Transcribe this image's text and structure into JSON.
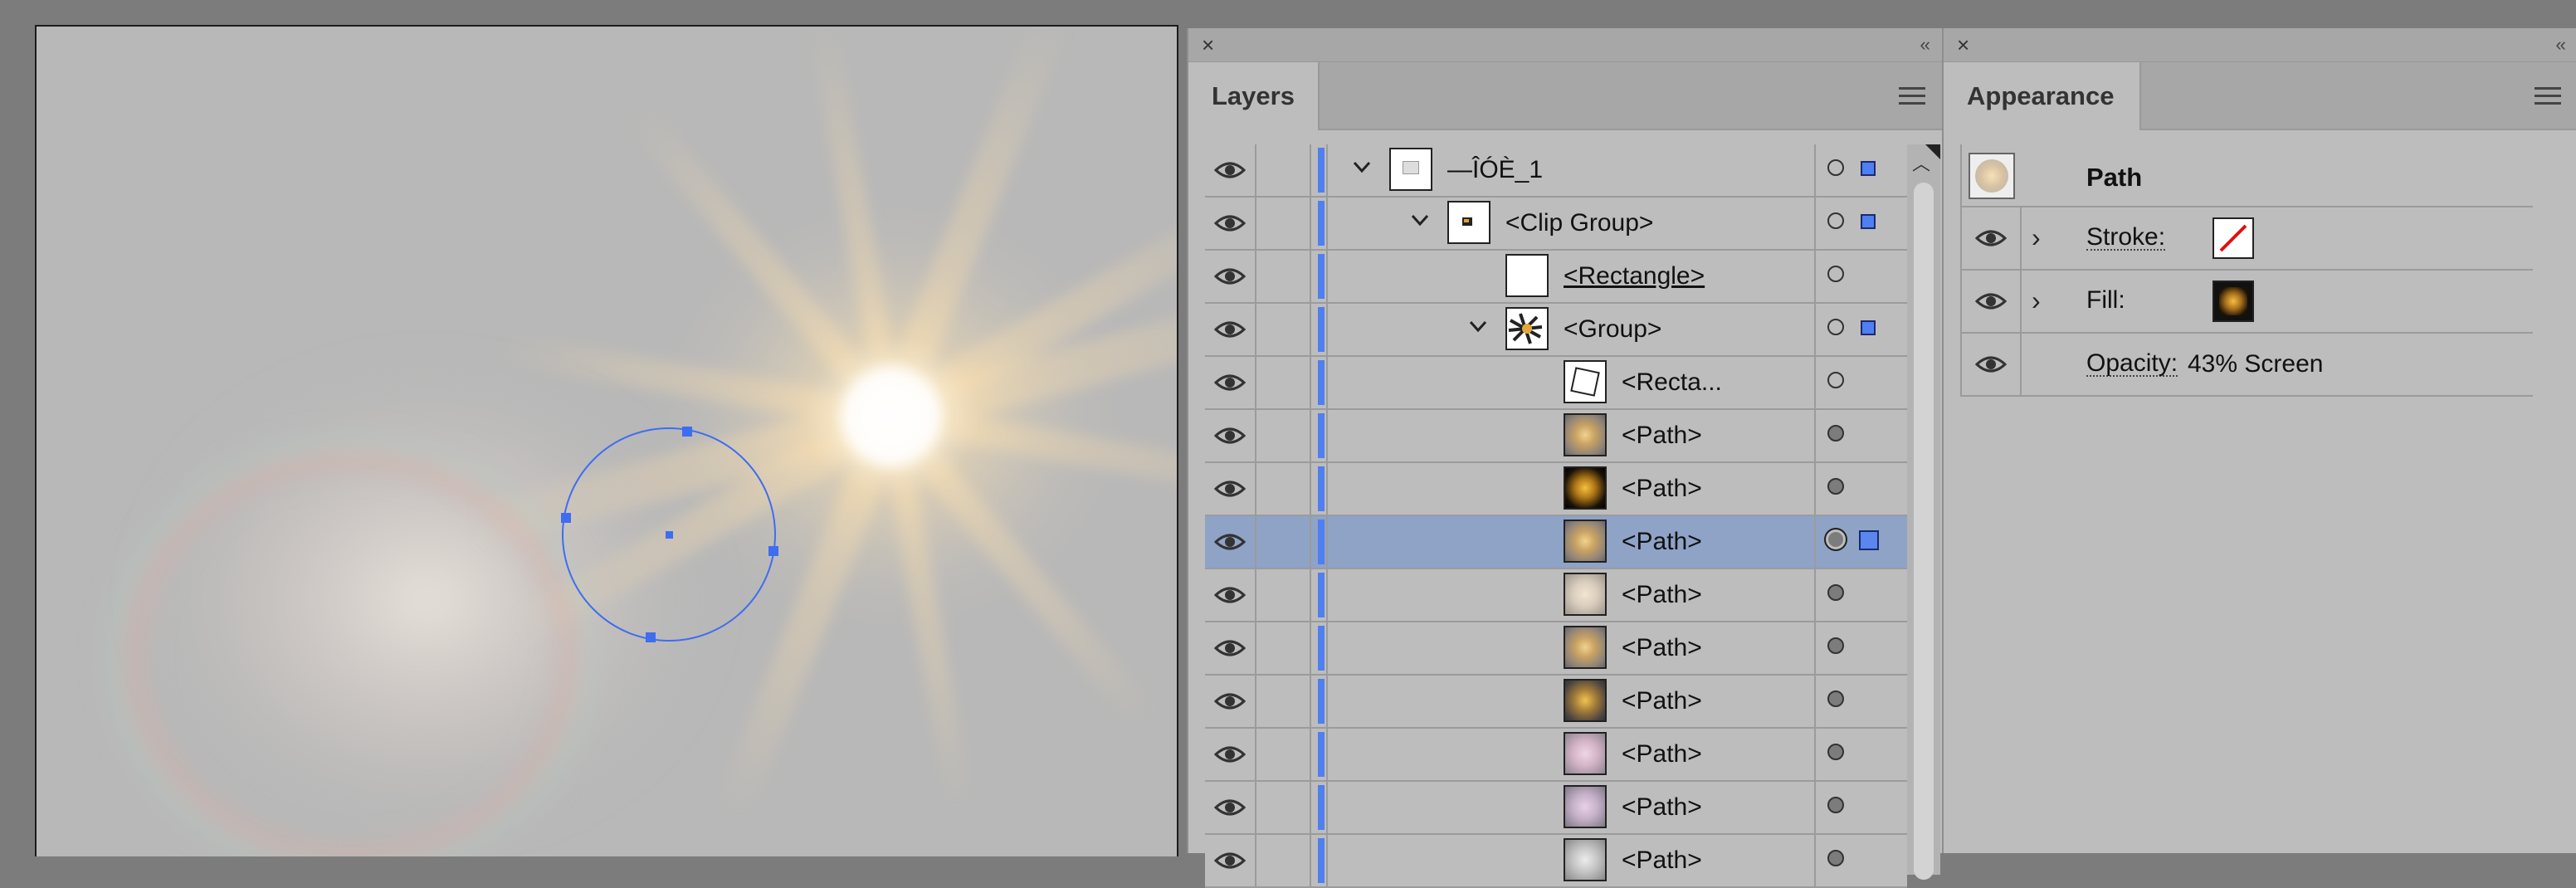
{
  "layers_panel": {
    "tab_label": "Layers",
    "rows": [
      {
        "indent": 0,
        "expanded": true,
        "name": "—ÎÓÈ_1",
        "thumb": "layer",
        "target": "open",
        "selected_sq": true
      },
      {
        "indent": 1,
        "expanded": true,
        "name": "<Clip Group>",
        "thumb": "clip",
        "target": "open",
        "selected_sq": true
      },
      {
        "indent": 2,
        "name": "<Rectangle>",
        "thumb": "white",
        "target": "open",
        "underline": true
      },
      {
        "indent": 2,
        "expanded": true,
        "name": "<Group>",
        "thumb": "burst",
        "target": "open",
        "selected_sq": true
      },
      {
        "indent": 3,
        "name": "<Recta...",
        "thumb": "rect",
        "target": "open"
      },
      {
        "indent": 3,
        "name": "<Path>",
        "thumb": "gold",
        "target": "filled"
      },
      {
        "indent": 3,
        "name": "<Path>",
        "thumb": "dark-gold",
        "target": "filled"
      },
      {
        "indent": 3,
        "name": "<Path>",
        "thumb": "gold",
        "target": "ring",
        "selected": true,
        "selected_sq": true
      },
      {
        "indent": 3,
        "name": "<Path>",
        "thumb": "light",
        "target": "filled"
      },
      {
        "indent": 3,
        "name": "<Path>",
        "thumb": "gold",
        "target": "filled"
      },
      {
        "indent": 3,
        "name": "<Path>",
        "thumb": "dark-gold2",
        "target": "filled"
      },
      {
        "indent": 3,
        "name": "<Path>",
        "thumb": "pink",
        "target": "filled"
      },
      {
        "indent": 3,
        "name": "<Path>",
        "thumb": "pink2",
        "target": "filled"
      },
      {
        "indent": 3,
        "name": "<Path>",
        "thumb": "grey",
        "target": "filled"
      }
    ]
  },
  "appearance_panel": {
    "tab_label": "Appearance",
    "object_type": "Path",
    "stroke_label": "Stroke:",
    "fill_label": "Fill:",
    "opacity_label": "Opacity:",
    "opacity_value": "43% Screen"
  },
  "colors": {
    "layer_color": "#4f7ff0",
    "selection_row": "#8fa3c7",
    "panel_bg": "#bdbdbd"
  }
}
